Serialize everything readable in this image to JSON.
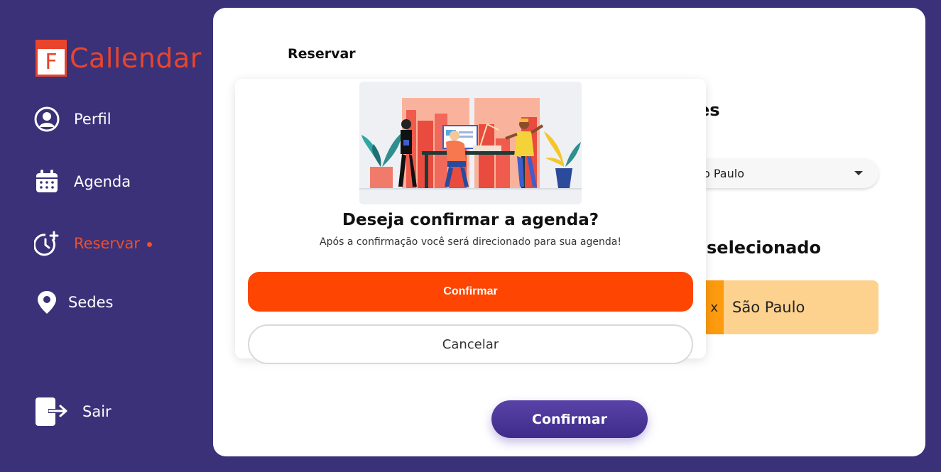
{
  "brand": {
    "logo_letter": "F",
    "name": "Callendar",
    "accent": "#e8452c"
  },
  "sidebar": {
    "items": [
      {
        "label": "Perfil",
        "icon": "user-circle-icon"
      },
      {
        "label": "Agenda",
        "icon": "calendar-icon"
      },
      {
        "label": "Reservar",
        "icon": "clock-plus-icon",
        "active": true
      },
      {
        "label": "Sedes",
        "icon": "map-pin-icon"
      }
    ],
    "logout": {
      "label": "Sair",
      "icon": "logout-icon"
    }
  },
  "main": {
    "title": "Reservar",
    "section_sedes_heading": "es",
    "select_value": "o Paulo",
    "section_selected_heading": "selecionado",
    "selected_card": {
      "strip_text": "x",
      "name": "São Paulo"
    },
    "confirm_label": "Confirmar"
  },
  "modal": {
    "title": "Deseja confirmar a agenda?",
    "subtitle": "Após a confirmação você será direcionado para sua agenda!",
    "confirm_label": "Confirmar",
    "cancel_label": "Cancelar"
  },
  "colors": {
    "background": "#3a3179",
    "primary_orange": "#fe4502",
    "active_nav": "#ef4f2a",
    "card": "#fdd28f",
    "card_strip": "#fd9a0e"
  }
}
